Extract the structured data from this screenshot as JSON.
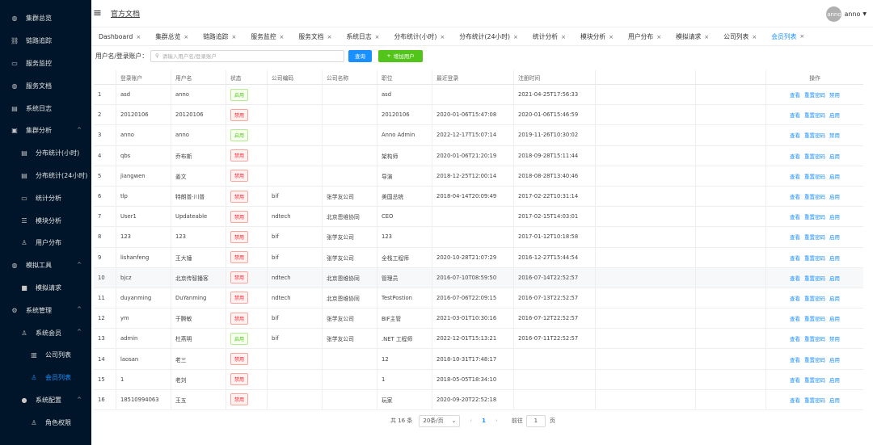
{
  "header": {
    "home_link": "官方文档",
    "avatar_text": "anno",
    "username": "anno"
  },
  "sidebar": [
    {
      "label": "集群总览",
      "icon": "home-icon",
      "glyph": "◍",
      "level": "top"
    },
    {
      "label": "链路追踪",
      "icon": "link-icon",
      "glyph": "⛓",
      "level": "top"
    },
    {
      "label": "服务监控",
      "icon": "monitor-icon",
      "glyph": "▭",
      "level": "top"
    },
    {
      "label": "服务文档",
      "icon": "doc-icon",
      "glyph": "◍",
      "level": "top"
    },
    {
      "label": "系统日志",
      "icon": "log-icon",
      "glyph": "▤",
      "level": "top"
    },
    {
      "label": "集群分析",
      "icon": "analysis-icon",
      "glyph": "▣",
      "level": "top",
      "arrow": "^"
    },
    {
      "label": "分布统计(小时)",
      "icon": "chart-icon",
      "glyph": "▤",
      "level": "child"
    },
    {
      "label": "分布统计(24小时)",
      "icon": "chart-icon",
      "glyph": "▤",
      "level": "child"
    },
    {
      "label": "统计分析",
      "icon": "monitor-icon",
      "glyph": "▭",
      "level": "child"
    },
    {
      "label": "模块分析",
      "icon": "module-icon",
      "glyph": "☰",
      "level": "child"
    },
    {
      "label": "用户分布",
      "icon": "user-icon",
      "glyph": "♙",
      "level": "child"
    },
    {
      "label": "模拟工具",
      "icon": "tool-icon",
      "glyph": "◍",
      "level": "top",
      "arrow": "^"
    },
    {
      "label": "模拟请求",
      "icon": "request-icon",
      "glyph": "■",
      "level": "child"
    },
    {
      "label": "系统管理",
      "icon": "gear-icon",
      "glyph": "⚙",
      "level": "top",
      "arrow": "^"
    },
    {
      "label": "系统会员",
      "icon": "user-icon",
      "glyph": "♙",
      "level": "child",
      "arrow": "^"
    },
    {
      "label": "公司列表",
      "icon": "company-icon",
      "glyph": "▥",
      "level": "grand"
    },
    {
      "label": "会员列表",
      "icon": "user-icon",
      "glyph": "♙",
      "level": "grand",
      "active": true
    },
    {
      "label": "系统配置",
      "icon": "config-icon",
      "glyph": "●",
      "level": "child",
      "arrow": "^"
    },
    {
      "label": "角色权限",
      "icon": "role-icon",
      "glyph": "♙",
      "level": "grand"
    }
  ],
  "tabs": [
    {
      "label": "Dashboard"
    },
    {
      "label": "集群总览"
    },
    {
      "label": "链路追踪"
    },
    {
      "label": "服务监控"
    },
    {
      "label": "服务文档"
    },
    {
      "label": "系统日志"
    },
    {
      "label": "分布统计(小时)"
    },
    {
      "label": "分布统计(24小时)"
    },
    {
      "label": "统计分析"
    },
    {
      "label": "模块分析"
    },
    {
      "label": "用户分布"
    },
    {
      "label": "模拟请求"
    },
    {
      "label": "公司列表"
    },
    {
      "label": "会员列表",
      "active": true
    }
  ],
  "search": {
    "label": "用户名/登录账户：",
    "placeholder": "请输入用户名/登录账户",
    "query_button": "查询",
    "add_button": "增加用户"
  },
  "table": {
    "columns": [
      "",
      "登录账户",
      "用户名",
      "状态",
      "公司编码",
      "公司名称",
      "职位",
      "最近登录",
      "注册时间",
      "",
      "",
      "操作"
    ],
    "rows": [
      {
        "no": "1",
        "account": "asd",
        "name": "anno",
        "status": "启用",
        "enabled": true,
        "code": "",
        "company": "",
        "position": "asd",
        "last": "",
        "reg": "2021-04-25T17:56:33",
        "op3": "禁用"
      },
      {
        "no": "2",
        "account": "20120106",
        "name": "20120106",
        "status": "禁用",
        "enabled": false,
        "code": "",
        "company": "",
        "position": "20120106",
        "last": "2020-01-06T15:47:08",
        "reg": "2020-01-06T15:46:59",
        "op3": "启用"
      },
      {
        "no": "3",
        "account": "anno",
        "name": "anno",
        "status": "启用",
        "enabled": true,
        "code": "",
        "company": "",
        "position": "Anno Admin",
        "last": "2022-12-17T15:07:14",
        "reg": "2019-11-26T10:30:02",
        "op3": "禁用"
      },
      {
        "no": "4",
        "account": "qbs",
        "name": "乔布斯",
        "status": "禁用",
        "enabled": false,
        "code": "",
        "company": "",
        "position": "架构师",
        "last": "2020-01-06T21:20:19",
        "reg": "2018-09-28T15:11:44",
        "op3": "启用"
      },
      {
        "no": "5",
        "account": "jiangwen",
        "name": "姜文",
        "status": "禁用",
        "enabled": false,
        "code": "",
        "company": "",
        "position": "导演",
        "last": "2018-12-25T12:00:14",
        "reg": "2018-08-28T13:40:46",
        "op3": "启用"
      },
      {
        "no": "6",
        "account": "tlp",
        "name": "特朗普·川普",
        "status": "禁用",
        "enabled": false,
        "code": "bif",
        "company": "张学友公司",
        "position": "美国总统",
        "last": "2018-04-14T20:09:49",
        "reg": "2017-02-22T10:31:14",
        "op3": "启用"
      },
      {
        "no": "7",
        "account": "User1",
        "name": "Updateable",
        "status": "禁用",
        "enabled": false,
        "code": "ndtech",
        "company": "北京恩维协同",
        "position": "CEO",
        "last": "",
        "reg": "2017-02-15T14:03:01",
        "op3": "启用"
      },
      {
        "no": "8",
        "account": "123",
        "name": "123",
        "status": "禁用",
        "enabled": false,
        "code": "bif",
        "company": "张学友公司",
        "position": "123",
        "last": "",
        "reg": "2017-01-12T10:18:58",
        "op3": "启用"
      },
      {
        "no": "9",
        "account": "lishanfeng",
        "name": "王大锤",
        "status": "禁用",
        "enabled": false,
        "code": "bif",
        "company": "张学友公司",
        "position": "全栈工程师",
        "last": "2020-10-28T21:07:29",
        "reg": "2016-12-27T15:44:54",
        "op3": "启用"
      },
      {
        "no": "10",
        "account": "bjcz",
        "name": "北京传智播客",
        "status": "禁用",
        "enabled": false,
        "code": "ndtech",
        "company": "北京恩维协同",
        "position": "管理员",
        "last": "2016-07-10T08:59:50",
        "reg": "2016-07-14T22:52:57",
        "op3": "启用"
      },
      {
        "no": "11",
        "account": "duyanming",
        "name": "DuYanming",
        "status": "禁用",
        "enabled": false,
        "code": "ndtech",
        "company": "北京恩维协同",
        "position": "TestPostion",
        "last": "2016-07-06T22:09:15",
        "reg": "2016-07-13T22:52:57",
        "op3": "启用"
      },
      {
        "no": "12",
        "account": "ym",
        "name": "于腾敏",
        "status": "禁用",
        "enabled": false,
        "code": "bif",
        "company": "张学友公司",
        "position": "BIF主管",
        "last": "2021-03-01T10:30:16",
        "reg": "2016-07-12T22:52:57",
        "op3": "启用"
      },
      {
        "no": "13",
        "account": "admin",
        "name": "杜燕明",
        "status": "启用",
        "enabled": true,
        "code": "bif",
        "company": "张学友公司",
        "position": ".NET 工程师",
        "last": "2022-12-01T15:13:21",
        "reg": "2016-07-11T22:52:57",
        "op3": "禁用"
      },
      {
        "no": "14",
        "account": "laosan",
        "name": "老三",
        "status": "禁用",
        "enabled": false,
        "code": "",
        "company": "",
        "position": "12",
        "last": "2018-10-31T17:48:17",
        "reg": "",
        "op3": "启用"
      },
      {
        "no": "15",
        "account": "1",
        "name": "老刘",
        "status": "禁用",
        "enabled": false,
        "code": "",
        "company": "",
        "position": "1",
        "last": "2018-05-05T18:34:10",
        "reg": "",
        "op3": "启用"
      },
      {
        "no": "16",
        "account": "18510994063",
        "name": "王五",
        "status": "禁用",
        "enabled": false,
        "code": "",
        "company": "",
        "position": "玩家",
        "last": "2020-09-20T22:52:18",
        "reg": "",
        "op3": "启用"
      }
    ],
    "op_view": "查看",
    "op_reset": "重置密码"
  },
  "pagination": {
    "total": "共 16 条",
    "page_size": "20条/页",
    "current": "1",
    "goto_label": "前往",
    "goto_value": "1",
    "page_word": "页"
  },
  "colors": {
    "sidebar_bg": "#001529",
    "accent": "#1890ff",
    "success": "#52c41a",
    "danger": "#f5222d"
  }
}
